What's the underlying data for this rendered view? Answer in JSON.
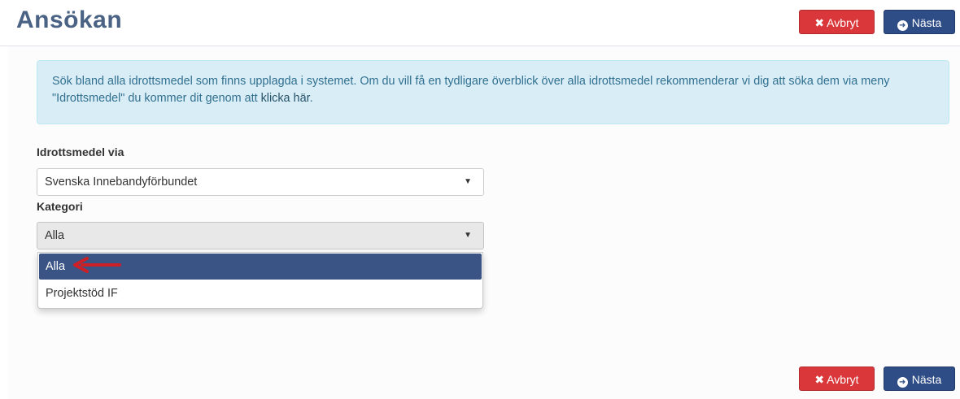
{
  "header": {
    "title": "Ansökan",
    "cancel_label": "Avbryt",
    "next_label": "Nästa"
  },
  "info": {
    "text": "Sök bland alla idrottsmedel som finns upplagda i systemet. Om du vill få en tydligare överblick över alla idrottsmedel rekommenderar vi dig att söka dem via meny \"Idrottsmedel\" du kommer dit genom att ",
    "link": "klicka här",
    "end": "."
  },
  "form": {
    "funding_via_label": "Idrottsmedel via",
    "funding_via_value": "Svenska Innebandyförbundet",
    "category_label": "Kategori",
    "category_value": "Alla",
    "category_options": [
      "Alla",
      "Projektstöd IF"
    ]
  },
  "footer": {
    "cancel_label": "Avbryt",
    "next_label": "Nästa"
  },
  "icons": {
    "cancel": "times-icon",
    "next": "arrow-circle-right-icon",
    "dropdown": "caret-down-icon",
    "annotation": "red-arrow-icon"
  },
  "colors": {
    "title": "#4a6283",
    "cancel_button": "#d9373a",
    "next_button": "#2e4c85",
    "alert_bg": "#d9edf7",
    "alert_text": "#31708f",
    "option_selected": "#3a5585",
    "annotation_arrow": "#cc1f26"
  }
}
